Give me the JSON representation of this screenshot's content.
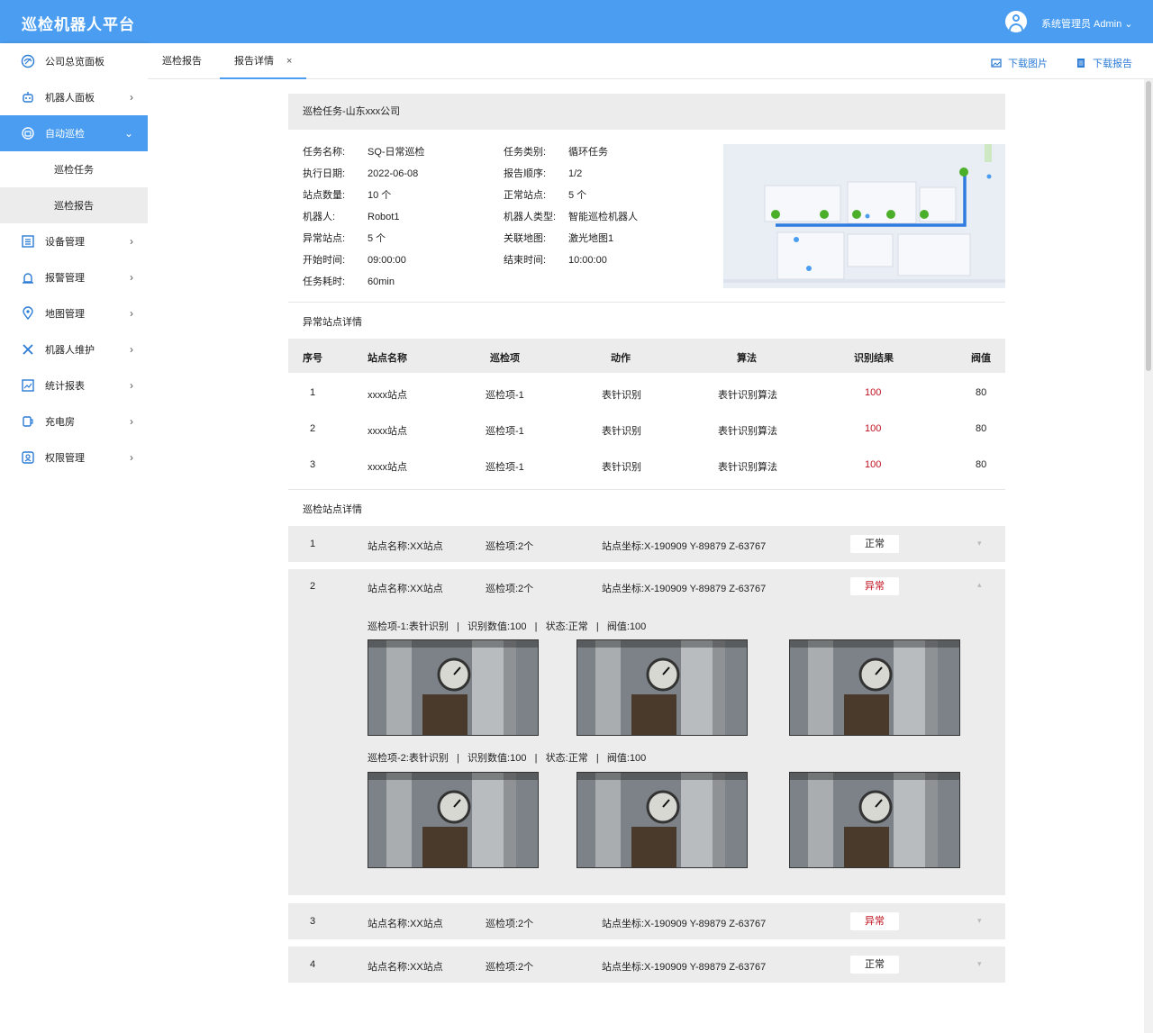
{
  "app": {
    "title": "巡检机器人平台",
    "user": "系统管理员 Admin ⌄"
  },
  "sidebar": {
    "items": [
      {
        "label": "公司总览面板",
        "icon": "dashboard-icon"
      },
      {
        "label": "机器人面板",
        "icon": "robot-icon"
      },
      {
        "label": "自动巡检",
        "icon": "auto-patrol-icon"
      },
      {
        "label": "设备管理",
        "icon": "device-icon"
      },
      {
        "label": "报警管理",
        "icon": "alarm-icon"
      },
      {
        "label": "地图管理",
        "icon": "map-pin-icon"
      },
      {
        "label": "机器人维护",
        "icon": "tools-icon"
      },
      {
        "label": "统计报表",
        "icon": "report-icon"
      },
      {
        "label": "充电房",
        "icon": "charging-icon"
      },
      {
        "label": "权限管理",
        "icon": "permission-icon"
      }
    ],
    "sub": [
      "巡检任务",
      "巡检报告"
    ]
  },
  "tabs": {
    "t1": "巡检报告",
    "t2": "报告详情",
    "close": "×"
  },
  "actions": {
    "download_image": "下载图片",
    "download_report": "下载报告"
  },
  "task": {
    "title": "巡检任务-山东xxx公司",
    "left": [
      {
        "k": "任务名称:",
        "v": "SQ-日常巡检"
      },
      {
        "k": "执行日期:",
        "v": "2022-06-08"
      },
      {
        "k": "站点数量:",
        "v": "10 个"
      },
      {
        "k": "机器人:",
        "v": "Robot1"
      },
      {
        "k": "异常站点:",
        "v": "5 个"
      },
      {
        "k": "开始时间:",
        "v": "09:00:00"
      },
      {
        "k": "任务耗时:",
        "v": "60min"
      }
    ],
    "right": [
      {
        "k": "任务类别:",
        "v": "循环任务"
      },
      {
        "k": "报告顺序:",
        "v": "1/2"
      },
      {
        "k": "正常站点:",
        "v": "5 个"
      },
      {
        "k": "机器人类型:",
        "v": "智能巡检机器人"
      },
      {
        "k": "关联地图:",
        "v": "激光地图1"
      },
      {
        "k": "结束时间:",
        "v": "10:00:00"
      }
    ]
  },
  "abnormal": {
    "title": "异常站点详情",
    "headers": [
      "序号",
      "站点名称",
      "巡检项",
      "动作",
      "算法",
      "识别结果",
      "阀值"
    ],
    "rows": [
      [
        "1",
        "xxxx站点",
        "巡检项-1",
        "表针识别",
        "表针识别算法",
        "100",
        "80"
      ],
      [
        "2",
        "xxxx站点",
        "巡检项-1",
        "表针识别",
        "表针识别算法",
        "100",
        "80"
      ],
      [
        "3",
        "xxxx站点",
        "巡检项-1",
        "表针识别",
        "表针识别算法",
        "100",
        "80"
      ]
    ]
  },
  "stations": {
    "title": "巡检站点详情",
    "rows": [
      {
        "no": "1",
        "name": "站点名称:XX站点",
        "items": "巡检项:2个",
        "coord": "站点坐标:X-190909 Y-89879 Z-63767",
        "status": "正常"
      },
      {
        "no": "2",
        "name": "站点名称:XX站点",
        "items": "巡检项:2个",
        "coord": "站点坐标:X-190909 Y-89879 Z-63767",
        "status": "异常"
      },
      {
        "no": "3",
        "name": "站点名称:XX站点",
        "items": "巡检项:2个",
        "coord": "站点坐标:X-190909 Y-89879 Z-63767",
        "status": "异常"
      },
      {
        "no": "4",
        "name": "站点名称:XX站点",
        "items": "巡检项:2个",
        "coord": "站点坐标:X-190909 Y-89879 Z-63767",
        "status": "正常"
      }
    ],
    "detail": [
      "巡检项-1:表针识别   |   识别数值:100   |   状态:正常   |   阀值:100",
      "巡检项-2:表针识别   |   识别数值:100   |   状态:正常   |   阀值:100"
    ]
  },
  "colors": {
    "primary": "#4a9df0",
    "danger": "#c0111f",
    "panel": "#ececec"
  }
}
